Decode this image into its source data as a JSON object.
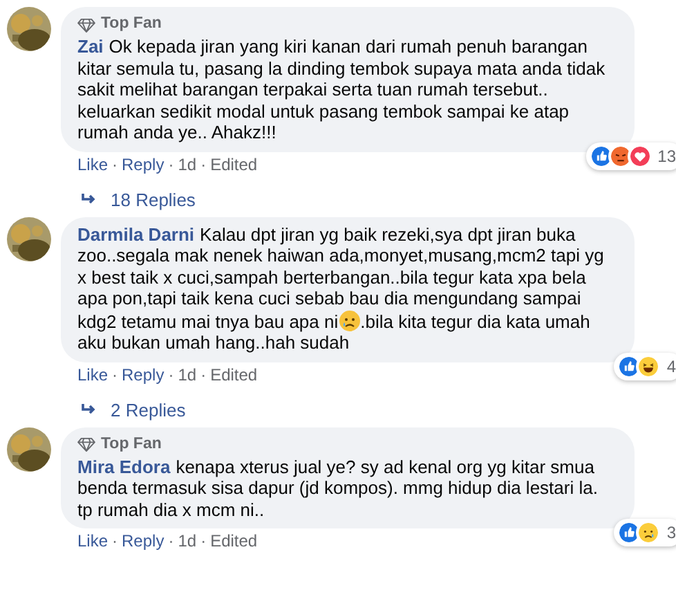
{
  "comments": [
    {
      "badge": "Top Fan",
      "author": "Zai",
      "segments": [
        {
          "kind": "text",
          "text": "Ok kepada jiran yang kiri kanan dari rumah penuh barangan kitar semula tu, pasang la dinding tembok supaya mata anda tidak sakit melihat barangan terpakai serta tuan rumah tersebut.. keluarkan sedikit modal untuk pasang tembok sampai ke atap rumah anda ye.. Ahakz!!!"
        }
      ],
      "actions": [
        "Like",
        "Reply",
        "1d",
        "Edited"
      ],
      "reactions": [
        {
          "kind": "like"
        },
        {
          "kind": "angry"
        },
        {
          "kind": "love"
        }
      ],
      "reaction_count": "13",
      "replies": "18 Replies"
    },
    {
      "author": "Darmila Darni",
      "segments": [
        {
          "kind": "text",
          "text": "Kalau dpt jiran yg baik rezeki,sya dpt jiran buka zoo..segala mak nenek haiwan ada,monyet,musang,mcm2 tapi yg x best taik x cuci,sampah berterbangan..bila tegur kata xpa bela apa pon,tapi taik kena cuci sebab bau dia mengundang sampai kdg2 tetamu mai tnya bau apa ni"
        },
        {
          "kind": "crying-emoji"
        },
        {
          "kind": "text",
          "text": ".bila kita tegur dia kata umah aku bukan umah hang..hah sudah"
        }
      ],
      "actions": [
        "Like",
        "Reply",
        "1d",
        "Edited"
      ],
      "reactions": [
        {
          "kind": "like"
        },
        {
          "kind": "haha"
        }
      ],
      "reaction_count": "4",
      "replies": "2 Replies"
    },
    {
      "badge": "Top Fan",
      "author": "Mira Edora",
      "segments": [
        {
          "kind": "text",
          "text": "kenapa xterus jual ye? sy ad kenal org yg kitar smua benda termasuk sisa dapur (jd kompos). mmg hidup dia lestari la. tp rumah dia x mcm ni.."
        }
      ],
      "actions": [
        "Like",
        "Reply",
        "1d",
        "Edited"
      ],
      "reactions": [
        {
          "kind": "like"
        },
        {
          "kind": "sad"
        }
      ],
      "reaction_count": "3"
    }
  ],
  "separator": "·"
}
